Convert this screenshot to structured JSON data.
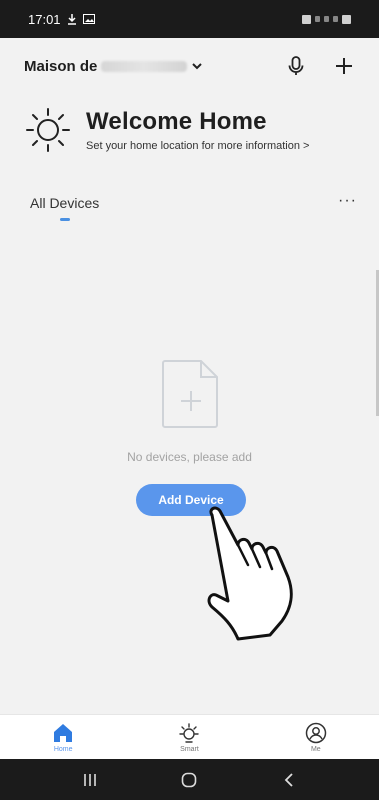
{
  "status_bar": {
    "time": "17:01"
  },
  "header": {
    "home_name": "Maison de"
  },
  "welcome": {
    "title": "Welcome Home",
    "subtitle": "Set your home location for more information >"
  },
  "tabs": {
    "all_devices": "All Devices",
    "more": "···"
  },
  "empty_state": {
    "message": "No devices, please add",
    "button_label": "Add Device"
  },
  "bottom_nav": {
    "items": [
      {
        "label": "Home"
      },
      {
        "label": "Smart"
      },
      {
        "label": "Me"
      }
    ]
  },
  "colors": {
    "accent": "#5a96ec",
    "nav_active": "#2f7be0"
  }
}
